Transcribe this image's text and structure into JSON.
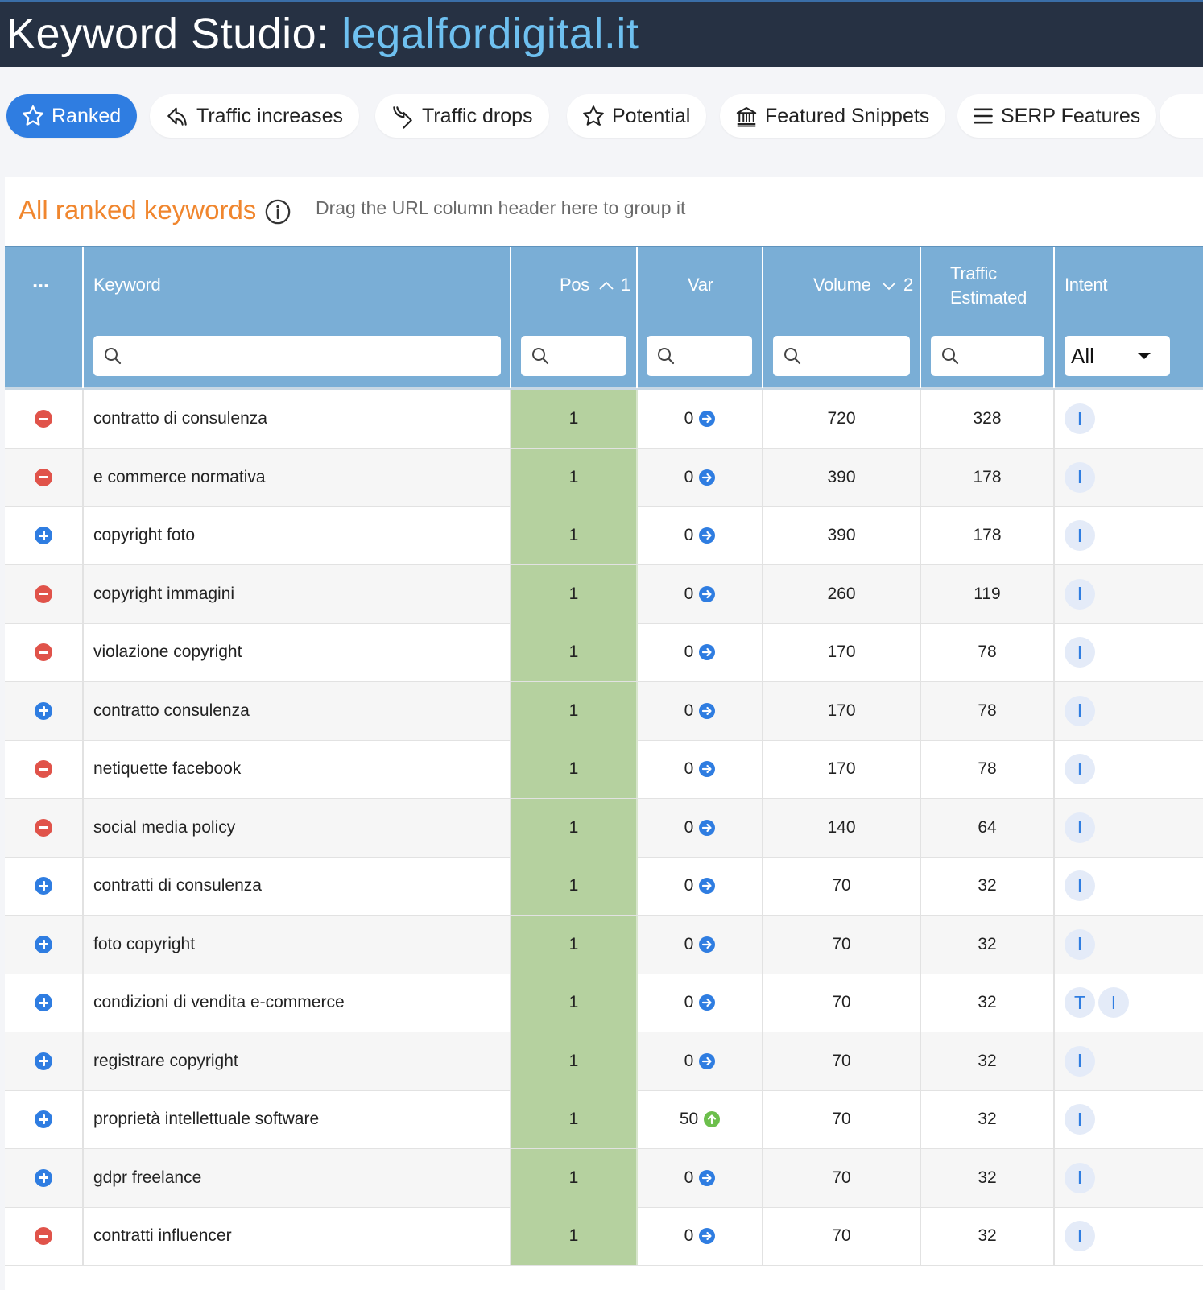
{
  "header": {
    "title_prefix": "Keyword Studio: ",
    "domain": "legalfordigital.it"
  },
  "filters": [
    {
      "label": "Ranked",
      "icon": "star-icon",
      "active": true
    },
    {
      "label": "Traffic increases",
      "icon": "trend-up-icon",
      "active": false
    },
    {
      "label": "Traffic drops",
      "icon": "trend-down-icon",
      "active": false
    },
    {
      "label": "Potential",
      "icon": "star-outline-icon",
      "active": false
    },
    {
      "label": "Featured Snippets",
      "icon": "bank-icon",
      "active": false
    },
    {
      "label": "SERP Features",
      "icon": "list-icon",
      "active": false
    }
  ],
  "panel": {
    "title": "All ranked keywords",
    "drag_hint": "Drag the URL column header here to group it"
  },
  "columns": {
    "menu": "...",
    "keyword": "Keyword",
    "pos": "Pos",
    "pos_sort_index": "1",
    "var": "Var",
    "volume": "Volume",
    "volume_sort_index": "2",
    "traffic_line1": "Traffic",
    "traffic_line2": "Estimated",
    "intent": "Intent",
    "intent_filter": "All"
  },
  "rows": [
    {
      "action": "remove",
      "keyword": "contratto di consulenza",
      "pos": "1",
      "var": "0",
      "var_dir": "flat",
      "volume": "720",
      "traffic": "328",
      "intent": [
        "I"
      ]
    },
    {
      "action": "remove",
      "keyword": "e commerce normativa",
      "pos": "1",
      "var": "0",
      "var_dir": "flat",
      "volume": "390",
      "traffic": "178",
      "intent": [
        "I"
      ]
    },
    {
      "action": "add",
      "keyword": "copyright foto",
      "pos": "1",
      "var": "0",
      "var_dir": "flat",
      "volume": "390",
      "traffic": "178",
      "intent": [
        "I"
      ]
    },
    {
      "action": "remove",
      "keyword": "copyright immagini",
      "pos": "1",
      "var": "0",
      "var_dir": "flat",
      "volume": "260",
      "traffic": "119",
      "intent": [
        "I"
      ]
    },
    {
      "action": "remove",
      "keyword": "violazione copyright",
      "pos": "1",
      "var": "0",
      "var_dir": "flat",
      "volume": "170",
      "traffic": "78",
      "intent": [
        "I"
      ]
    },
    {
      "action": "add",
      "keyword": "contratto consulenza",
      "pos": "1",
      "var": "0",
      "var_dir": "flat",
      "volume": "170",
      "traffic": "78",
      "intent": [
        "I"
      ]
    },
    {
      "action": "remove",
      "keyword": "netiquette facebook",
      "pos": "1",
      "var": "0",
      "var_dir": "flat",
      "volume": "170",
      "traffic": "78",
      "intent": [
        "I"
      ]
    },
    {
      "action": "remove",
      "keyword": "social media policy",
      "pos": "1",
      "var": "0",
      "var_dir": "flat",
      "volume": "140",
      "traffic": "64",
      "intent": [
        "I"
      ]
    },
    {
      "action": "add",
      "keyword": "contratti di consulenza",
      "pos": "1",
      "var": "0",
      "var_dir": "flat",
      "volume": "70",
      "traffic": "32",
      "intent": [
        "I"
      ]
    },
    {
      "action": "add",
      "keyword": "foto copyright",
      "pos": "1",
      "var": "0",
      "var_dir": "flat",
      "volume": "70",
      "traffic": "32",
      "intent": [
        "I"
      ]
    },
    {
      "action": "add",
      "keyword": "condizioni di vendita e-commerce",
      "pos": "1",
      "var": "0",
      "var_dir": "flat",
      "volume": "70",
      "traffic": "32",
      "intent": [
        "T",
        "I"
      ]
    },
    {
      "action": "add",
      "keyword": "registrare copyright",
      "pos": "1",
      "var": "0",
      "var_dir": "flat",
      "volume": "70",
      "traffic": "32",
      "intent": [
        "I"
      ]
    },
    {
      "action": "add",
      "keyword": "proprietà intellettuale software",
      "pos": "1",
      "var": "50",
      "var_dir": "up",
      "volume": "70",
      "traffic": "32",
      "intent": [
        "I"
      ]
    },
    {
      "action": "add",
      "keyword": "gdpr freelance",
      "pos": "1",
      "var": "0",
      "var_dir": "flat",
      "volume": "70",
      "traffic": "32",
      "intent": [
        "I"
      ]
    },
    {
      "action": "remove",
      "keyword": "contratti influencer",
      "pos": "1",
      "var": "0",
      "var_dir": "flat",
      "volume": "70",
      "traffic": "32",
      "intent": [
        "I"
      ]
    }
  ]
}
